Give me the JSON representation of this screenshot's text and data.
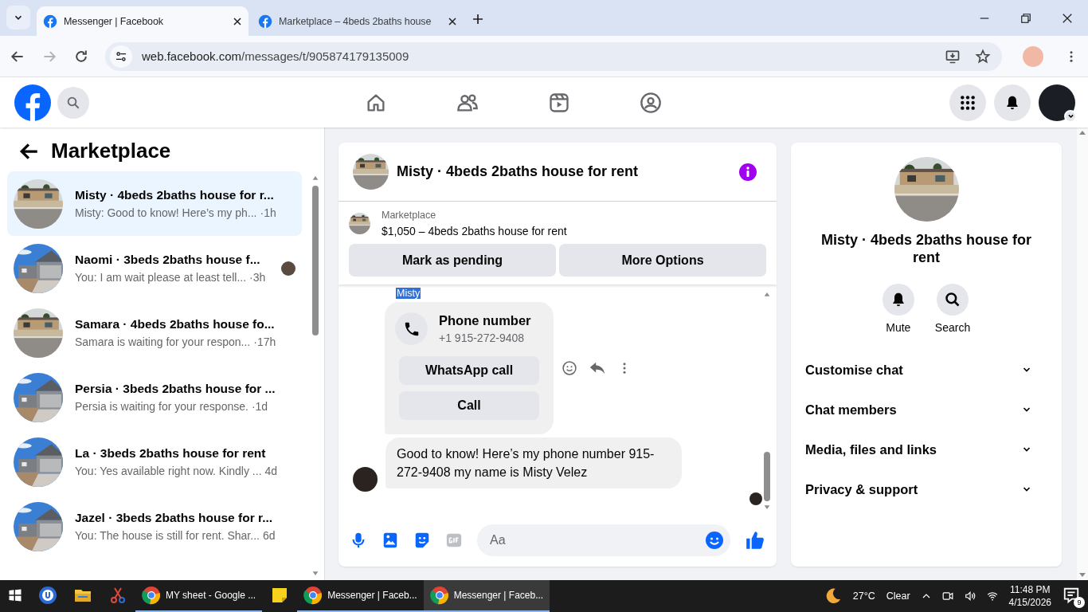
{
  "browser": {
    "tabs": [
      {
        "title": "Messenger | Facebook",
        "selected": true
      },
      {
        "title": "Marketplace – 4beds 2baths house",
        "selected": false
      }
    ],
    "url": {
      "host": "web.facebook.com",
      "path": "/messages/t/905874179135009"
    }
  },
  "nav": [
    {
      "kind": "home"
    },
    {
      "kind": "friends"
    },
    {
      "kind": "video"
    },
    {
      "kind": "groups"
    }
  ],
  "sidebar": {
    "title": "Marketplace",
    "conversations": [
      {
        "name": "Misty · 4beds 2baths house for r...",
        "preview": "Misty: Good to know! Here’s my ph...",
        "time": "·1h",
        "selected": true,
        "seen": false
      },
      {
        "name": "Naomi · 3beds 2baths house f...",
        "preview": "You: I am wait please at least tell...",
        "time": "·3h",
        "selected": false,
        "seen": true
      },
      {
        "name": "Samara · 4beds 2baths house fo...",
        "preview": "Samara is waiting for your respon...",
        "time": "·17h",
        "selected": false,
        "seen": false
      },
      {
        "name": "Persia · 3beds 2baths house for ...",
        "preview": "Persia is waiting for your response.",
        "time": "·1d",
        "selected": false,
        "seen": false
      },
      {
        "name": "La · 3beds 2baths house for rent",
        "preview": "You: Yes available right now. Kindly ...",
        "time": "4d",
        "selected": false,
        "seen": false
      },
      {
        "name": "Jazel · 3beds 2baths house for r...",
        "preview": "You: The house is still for rent. Shar...",
        "time": "6d",
        "selected": false,
        "seen": false
      }
    ]
  },
  "chat": {
    "title": "Misty · 4beds 2baths house for rent",
    "listing": {
      "label": "Marketplace",
      "title": "$1,050 – 4beds 2baths house for rent",
      "buttons": [
        "Mark as pending",
        "More Options"
      ]
    },
    "sender": "Misty",
    "phone_card": {
      "title": "Phone number",
      "number": "+1 915-272-9408",
      "buttons": [
        "WhatsApp call",
        "Call"
      ]
    },
    "message": "Good to know! Here’s my phone number 915-272-9408 my name is Misty Velez",
    "composer": {
      "placeholder": "Aa"
    }
  },
  "info_panel": {
    "name": "Misty · 4beds 2baths house for rent",
    "actions": [
      {
        "kind": "mute",
        "label": "Mute"
      },
      {
        "kind": "search",
        "label": "Search"
      }
    ],
    "sections": [
      {
        "label": "Customise chat",
        "expanded": false
      },
      {
        "label": "Chat members",
        "expanded": false
      },
      {
        "label": "Media, files and links",
        "expanded": false
      },
      {
        "label": "Privacy & support",
        "expanded": false
      }
    ]
  },
  "taskbar": {
    "apps": [
      {
        "kind": "security",
        "selected": false
      },
      {
        "kind": "folder",
        "selected": false
      },
      {
        "kind": "snip",
        "selected": false
      },
      {
        "kind": "chrome",
        "label": "MY sheet - Google ...",
        "selected": false
      },
      {
        "kind": "notes",
        "selected": false
      },
      {
        "kind": "chrome",
        "label": "Messenger | Faceb...",
        "selected": false
      },
      {
        "kind": "chrome",
        "label": "Messenger | Faceb...",
        "selected": true
      }
    ],
    "weather": {
      "temp": "27°C",
      "condition": "Clear"
    },
    "time": "11:48 PM",
    "date": "4/15/2026",
    "notifications": "9"
  }
}
